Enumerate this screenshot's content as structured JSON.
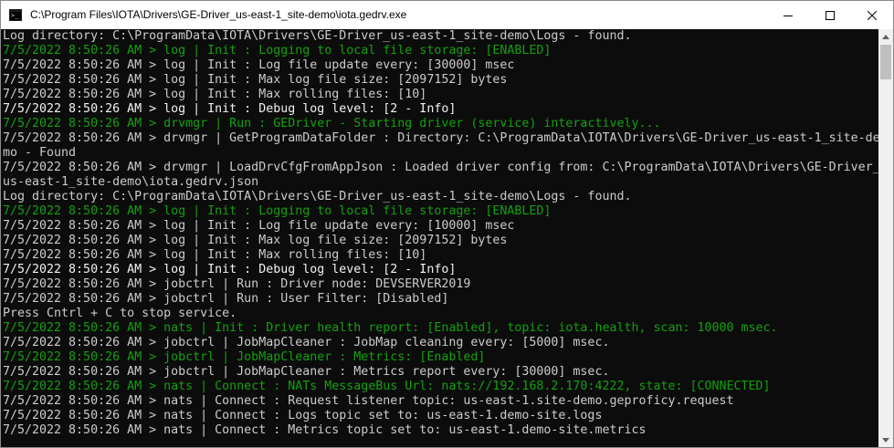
{
  "window": {
    "title": "C:\\Program Files\\IOTA\\Drivers\\GE-Driver_us-east-1_site-demo\\iota.gedrv.exe",
    "icon": "console-app-icon",
    "controls": [
      "minimize-icon",
      "maximize-icon",
      "close-icon"
    ]
  },
  "console": {
    "lines": [
      {
        "text": "Log directory: C:\\ProgramData\\IOTA\\Drivers\\GE-Driver_us-east-1_site-demo\\Logs - found.",
        "style": "normal"
      },
      {
        "text": "7/5/2022 8:50:26 AM > log | Init : Logging to local file storage: [ENABLED]",
        "style": "green"
      },
      {
        "text": "7/5/2022 8:50:26 AM > log | Init : Log file update every: [30000] msec",
        "style": "normal"
      },
      {
        "text": "7/5/2022 8:50:26 AM > log | Init : Max log file size: [2097152] bytes",
        "style": "normal"
      },
      {
        "text": "7/5/2022 8:50:26 AM > log | Init : Max rolling files: [10]",
        "style": "normal"
      },
      {
        "text": "7/5/2022 8:50:26 AM > log | Init : Debug log level: [2 - Info]",
        "style": "bold"
      },
      {
        "text": "7/5/2022 8:50:26 AM > drvmgr | Run : GEDriver - Starting driver (service) interactively...",
        "style": "green"
      },
      {
        "text": "7/5/2022 8:50:26 AM > drvmgr | GetProgramDataFolder : Directory: C:\\ProgramData\\IOTA\\Drivers\\GE-Driver_us-east-1_site-de",
        "style": "normal"
      },
      {
        "text": "mo - Found",
        "style": "normal"
      },
      {
        "text": "7/5/2022 8:50:26 AM > drvmgr | LoadDrvCfgFromAppJson : Loaded driver config from: C:\\ProgramData\\IOTA\\Drivers\\GE-Driver_",
        "style": "normal"
      },
      {
        "text": "us-east-1_site-demo\\iota.gedrv.json",
        "style": "normal"
      },
      {
        "text": "Log directory: C:\\ProgramData\\IOTA\\Drivers\\GE-Driver_us-east-1_site-demo\\Logs - found.",
        "style": "normal"
      },
      {
        "text": "7/5/2022 8:50:26 AM > log | Init : Logging to local file storage: [ENABLED]",
        "style": "green"
      },
      {
        "text": "7/5/2022 8:50:26 AM > log | Init : Log file update every: [10000] msec",
        "style": "normal"
      },
      {
        "text": "7/5/2022 8:50:26 AM > log | Init : Max log file size: [2097152] bytes",
        "style": "normal"
      },
      {
        "text": "7/5/2022 8:50:26 AM > log | Init : Max rolling files: [10]",
        "style": "normal"
      },
      {
        "text": "7/5/2022 8:50:26 AM > log | Init : Debug log level: [2 - Info]",
        "style": "bold"
      },
      {
        "text": "7/5/2022 8:50:26 AM > jobctrl | Run : Driver node: DEVSERVER2019",
        "style": "normal"
      },
      {
        "text": "7/5/2022 8:50:26 AM > jobctrl | Run : User Filter: [Disabled]",
        "style": "normal"
      },
      {
        "text": "Press Cntrl + C to stop service.",
        "style": "normal"
      },
      {
        "text": "7/5/2022 8:50:26 AM > nats | Init : Driver health report: [Enabled], topic: iota.health, scan: 10000 msec.",
        "style": "green"
      },
      {
        "text": "7/5/2022 8:50:26 AM > jobctrl | JobMapCleaner : JobMap cleaning every: [5000] msec.",
        "style": "normal"
      },
      {
        "text": "7/5/2022 8:50:26 AM > jobctrl | JobMapCleaner : Metrics: [Enabled]",
        "style": "green"
      },
      {
        "text": "7/5/2022 8:50:26 AM > jobctrl | JobMapCleaner : Metrics report every: [30000] msec.",
        "style": "normal"
      },
      {
        "text": "7/5/2022 8:50:26 AM > nats | Connect : NATs MessageBus Url: nats://192.168.2.170:4222, state: [CONNECTED]",
        "style": "green"
      },
      {
        "text": "7/5/2022 8:50:26 AM > nats | Connect : Request listener topic: us-east-1.site-demo.geproficy.request",
        "style": "normal"
      },
      {
        "text": "7/5/2022 8:50:26 AM > nats | Connect : Logs topic set to: us-east-1.demo-site.logs",
        "style": "normal"
      },
      {
        "text": "7/5/2022 8:50:26 AM > nats | Connect : Metrics topic set to: us-east-1.demo-site.metrics",
        "style": "normal"
      }
    ]
  },
  "scrollbar": {
    "up_icon": "scroll-up-arrow-icon",
    "down_icon": "scroll-down-arrow-icon",
    "thumb_visible_fraction": 0.09
  },
  "colors": {
    "background": "#0c0c0c",
    "text": "#cccccc",
    "green": "#13a10e",
    "bright": "#f2f2f2"
  }
}
